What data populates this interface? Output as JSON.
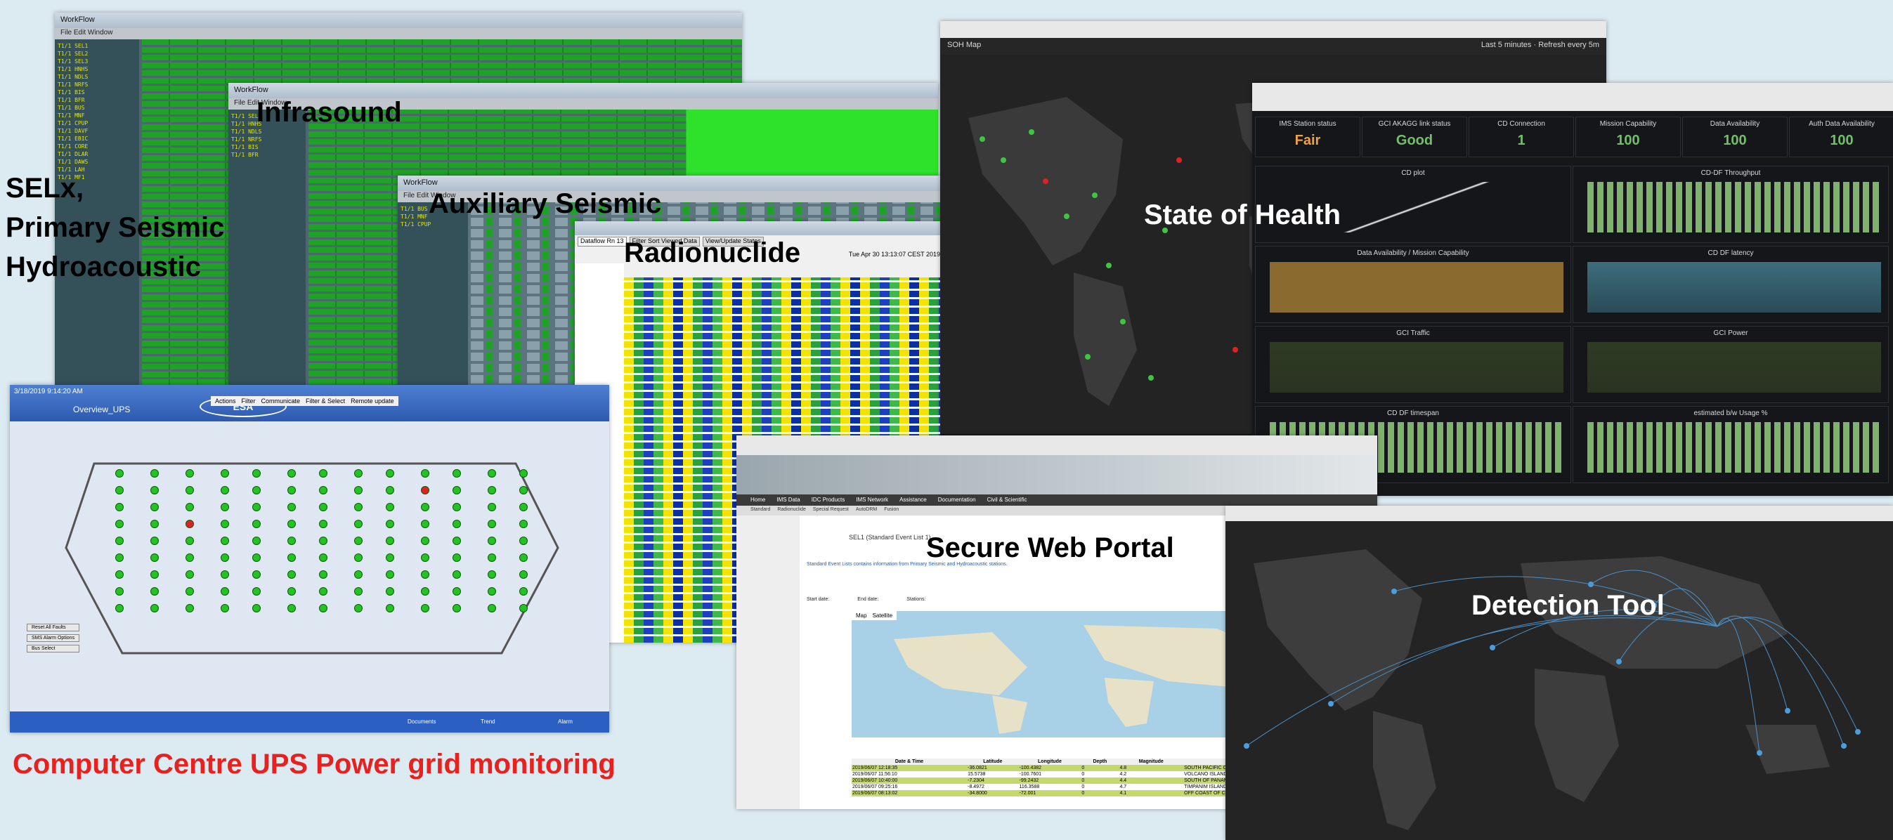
{
  "labels": {
    "selx_line1": "SELx,",
    "selx_line2": "Primary Seismic",
    "selx_line3": "Hydroacoustic",
    "infrasound": "Infrasound",
    "auxiliary": "Auxiliary Seismic",
    "radionuclide": "Radionuclide",
    "soh": "State of Health",
    "portal": "Secure Web Portal",
    "detection": "Detection Tool",
    "ups": "Computer Centre UPS Power grid monitoring"
  },
  "workflow": {
    "title": "WorkFlow",
    "menu": "File  Edit  Window",
    "rows": [
      "T1/1 SEL1",
      "T1/1 SEL2",
      "T1/1 SEL3",
      "T1/1 HNHS",
      "T1/1 NDLS",
      "T1/1 NRFS",
      "T1/1 BIS",
      "T1/1 BFR",
      "T1/1 BUS",
      "T1/1 MNF",
      "T1/1 CPUP",
      "T1/1 DAVF",
      "T1/1 EBIC",
      "T1/1 CORE",
      "T1/1 DLAR",
      "T1/1 DAWS",
      "T1/1 LAH",
      "T1/1 MF1"
    ]
  },
  "radionuclide": {
    "tabs": [
      "Dataflow Rn 13",
      "Filter Sort Viewed Data",
      "View/Update States"
    ],
    "date": "Tue Apr 30 13:13:07 CEST 2019"
  },
  "soh": {
    "title": "SOH Map",
    "range": "Last 5 minutes",
    "refresh": "Refresh every 5m",
    "stats": [
      {
        "title": "IMS Station status",
        "value": "Fair",
        "color": "#f2a142"
      },
      {
        "title": "GCI AKAGG link status",
        "value": "Good",
        "color": "#73bf69"
      },
      {
        "title": "CD Connection",
        "value": "1",
        "color": "#73bf69"
      },
      {
        "title": "Mission Capability",
        "value": "100",
        "color": "#73bf69"
      },
      {
        "title": "Data Availability",
        "value": "100",
        "color": "#73bf69"
      },
      {
        "title": "Auth Data Availability",
        "value": "100",
        "color": "#73bf69"
      }
    ],
    "panels": [
      "CD plot",
      "CD-DF Throughput",
      "Data Availability / Mission Capability",
      "CD DF latency",
      "GCI Traffic",
      "GCI Power",
      "CD DF timespan",
      "estimated b/w Usage %"
    ]
  },
  "portal": {
    "nav": [
      "Home",
      "IMS Data",
      "IDC Products",
      "IMS Network",
      "Assistance",
      "Documentation",
      "Civil & Scientific"
    ],
    "sub_nav": [
      "Standard",
      "Radionuclide",
      "Special Request",
      "AutoDRM",
      "Fusion"
    ],
    "heading": "SEL1 (Standard Event List 1)",
    "intro": "Standard Event Lists contains information from Primary Seismic and Hydroacoustic stations.",
    "map_tabs": [
      "Map",
      "Satellite"
    ],
    "start_date_label": "Start date:",
    "end_date_label": "End date:",
    "stations_label": "Stations:",
    "table_headers": [
      "Date & Time",
      "Latitude",
      "Longitude",
      "Depth",
      "Magnitude",
      "Region"
    ],
    "table_rows": [
      [
        "2019/06/07 12:18:35",
        "-36.0821",
        "-100.4382",
        "0",
        "4.8",
        "SOUTH PACIFIC OCEAN"
      ],
      [
        "2019/06/07 11:56:10",
        "15.5738",
        "-100.7601",
        "0",
        "4.2",
        "VOLCANO ISLANDS REGION"
      ],
      [
        "2019/06/07 10:40:00",
        "-7.2304",
        "-99.2432",
        "0",
        "4.4",
        "SOUTH OF PANAMA"
      ],
      [
        "2019/06/07 09:25:16",
        "-8.4972",
        "116.3588",
        "0",
        "4.7",
        "TIMPANIM ISLANDS REG."
      ],
      [
        "2019/06/07 08:13:02",
        "-34.8000",
        "-72.001",
        "0",
        "4.1",
        "OFF COAST OF CENTRAL CHILE"
      ]
    ]
  },
  "ups": {
    "title": "Overview_UPS",
    "date": "3/18/2019 9:14:20 AM",
    "logo": "ESA",
    "buttons": [
      "Reset All Faults",
      "SMS Alarm Options",
      "Bus Select"
    ],
    "footer": [
      "Documents",
      "Trend",
      "Alarm"
    ],
    "tabs": [
      "Actions",
      "Filter",
      "Communicate",
      "Filter & Select",
      "Remote update"
    ]
  },
  "colors": {
    "ups_label": "#e8201e",
    "grid_green": "#1fa326",
    "soh_bg": "#161719"
  }
}
